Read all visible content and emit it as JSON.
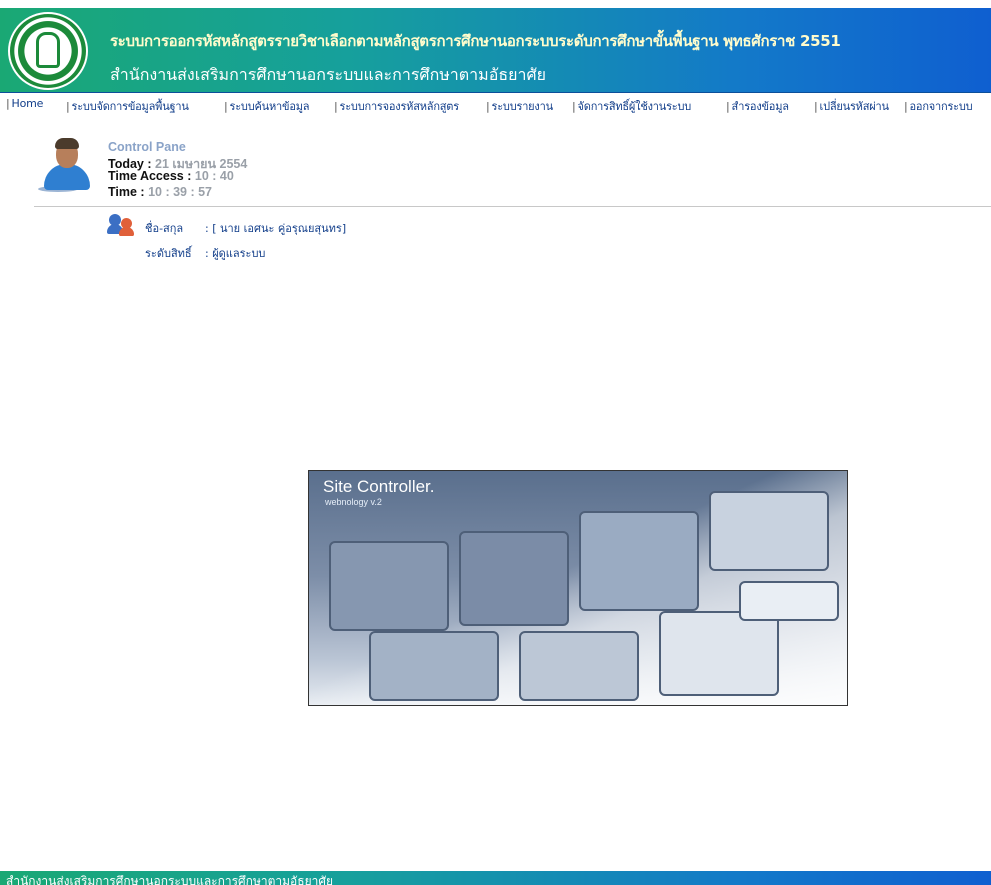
{
  "header": {
    "title": "ระบบการออกรหัสหลักสูตรรายวิชาเลือกตามหลักสูตรการศึกษานอกระบบระดับการศึกษาขั้นพื้นฐาน พุทธศักราช 2551",
    "subtitle": "สำนักงานส่งเสริมการศึกษานอกระบบและการศึกษาตามอัธยาศัย"
  },
  "nav": {
    "items": [
      {
        "label": "Home"
      },
      {
        "label": "ระบบจัดการข้อมูลพื้นฐาน"
      },
      {
        "label": "ระบบค้นหาข้อมูล"
      },
      {
        "label": "ระบบการจองรหัสหลักสูตร"
      },
      {
        "label": "ระบบรายงาน"
      },
      {
        "label": "จัดการสิทธิ์ผู้ใช้งานระบบ"
      },
      {
        "label": "สำรองข้อมูล"
      },
      {
        "label": "เปลี่ยนรหัสผ่าน"
      },
      {
        "label": "ออกจากระบบ"
      }
    ]
  },
  "control_panel": {
    "title": "Control Pane",
    "today_label": "Today :",
    "today_value": "21 เมษายน 2554",
    "access_label": "Time Access :",
    "access_value": "10 : 40",
    "time_label": "Time :",
    "time_value": "10 : 39 : 57"
  },
  "user": {
    "name_label": "ชื่อ-สกุล",
    "name_value": ": [ นาย เอศนะ คู่อรุณยสุนทร]",
    "role_label": "ระดับสิทธิ์",
    "role_value": ": ผู้ดูแลระบบ"
  },
  "site_image": {
    "title": "Site Controller.",
    "subtitle": "webnology v.2"
  },
  "footer": {
    "text": "สำนักงานส่งเสริมการศึกษานอกระบบและการศึกษาตามอัธยาศัย"
  },
  "colors": {
    "header_start": "#1aa874",
    "header_end": "#0f5fd0",
    "nav_link": "#123e8a"
  },
  "icons": {
    "logo": "emblem-logo",
    "avatar": "user-avatar-icon",
    "users": "users-icon"
  }
}
